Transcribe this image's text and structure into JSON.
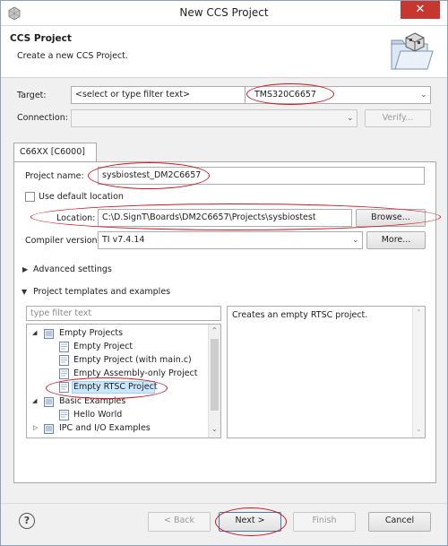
{
  "window": {
    "title": "New CCS Project",
    "close_glyph": "✕"
  },
  "banner": {
    "title": "CCS Project",
    "description": "Create a new CCS Project."
  },
  "target": {
    "label": "Target:",
    "filter_value": "<select or type filter text>",
    "device_value": "TMS320C6657"
  },
  "connection": {
    "label": "Connection:",
    "value": "",
    "verify_label": "Verify..."
  },
  "tab": {
    "label": "C66XX [C6000]"
  },
  "project": {
    "name_label": "Project name:",
    "name_value": "sysbiostest_DM2C6657",
    "use_default_location_label": "Use default location",
    "location_label": "Location:",
    "location_value": "C:\\D.SignT\\Boards\\DM2C6657\\Projects\\sysbiostest",
    "browse_label": "Browse...",
    "compiler_label": "Compiler version:",
    "compiler_value": "TI v7.4.14",
    "more_label": "More..."
  },
  "sections": {
    "advanced_label": "Advanced settings",
    "templates_label": "Project templates and examples"
  },
  "templates": {
    "filter_placeholder": "type filter text",
    "tree": [
      {
        "label": "Empty Projects"
      },
      {
        "label": "Empty Project"
      },
      {
        "label": "Empty Project (with main.c)"
      },
      {
        "label": "Empty Assembly-only Project"
      },
      {
        "label": "Empty RTSC Project"
      },
      {
        "label": "Basic Examples"
      },
      {
        "label": "Hello World"
      },
      {
        "label": "IPC and I/O Examples"
      }
    ],
    "description": "Creates an empty RTSC project."
  },
  "footer": {
    "help_glyph": "?",
    "back_label": "< Back",
    "next_label": "Next >",
    "finish_label": "Finish",
    "cancel_label": "Cancel"
  },
  "colors": {
    "annotation_red": "#d6141c",
    "selection_blue": "#cce8ff"
  }
}
